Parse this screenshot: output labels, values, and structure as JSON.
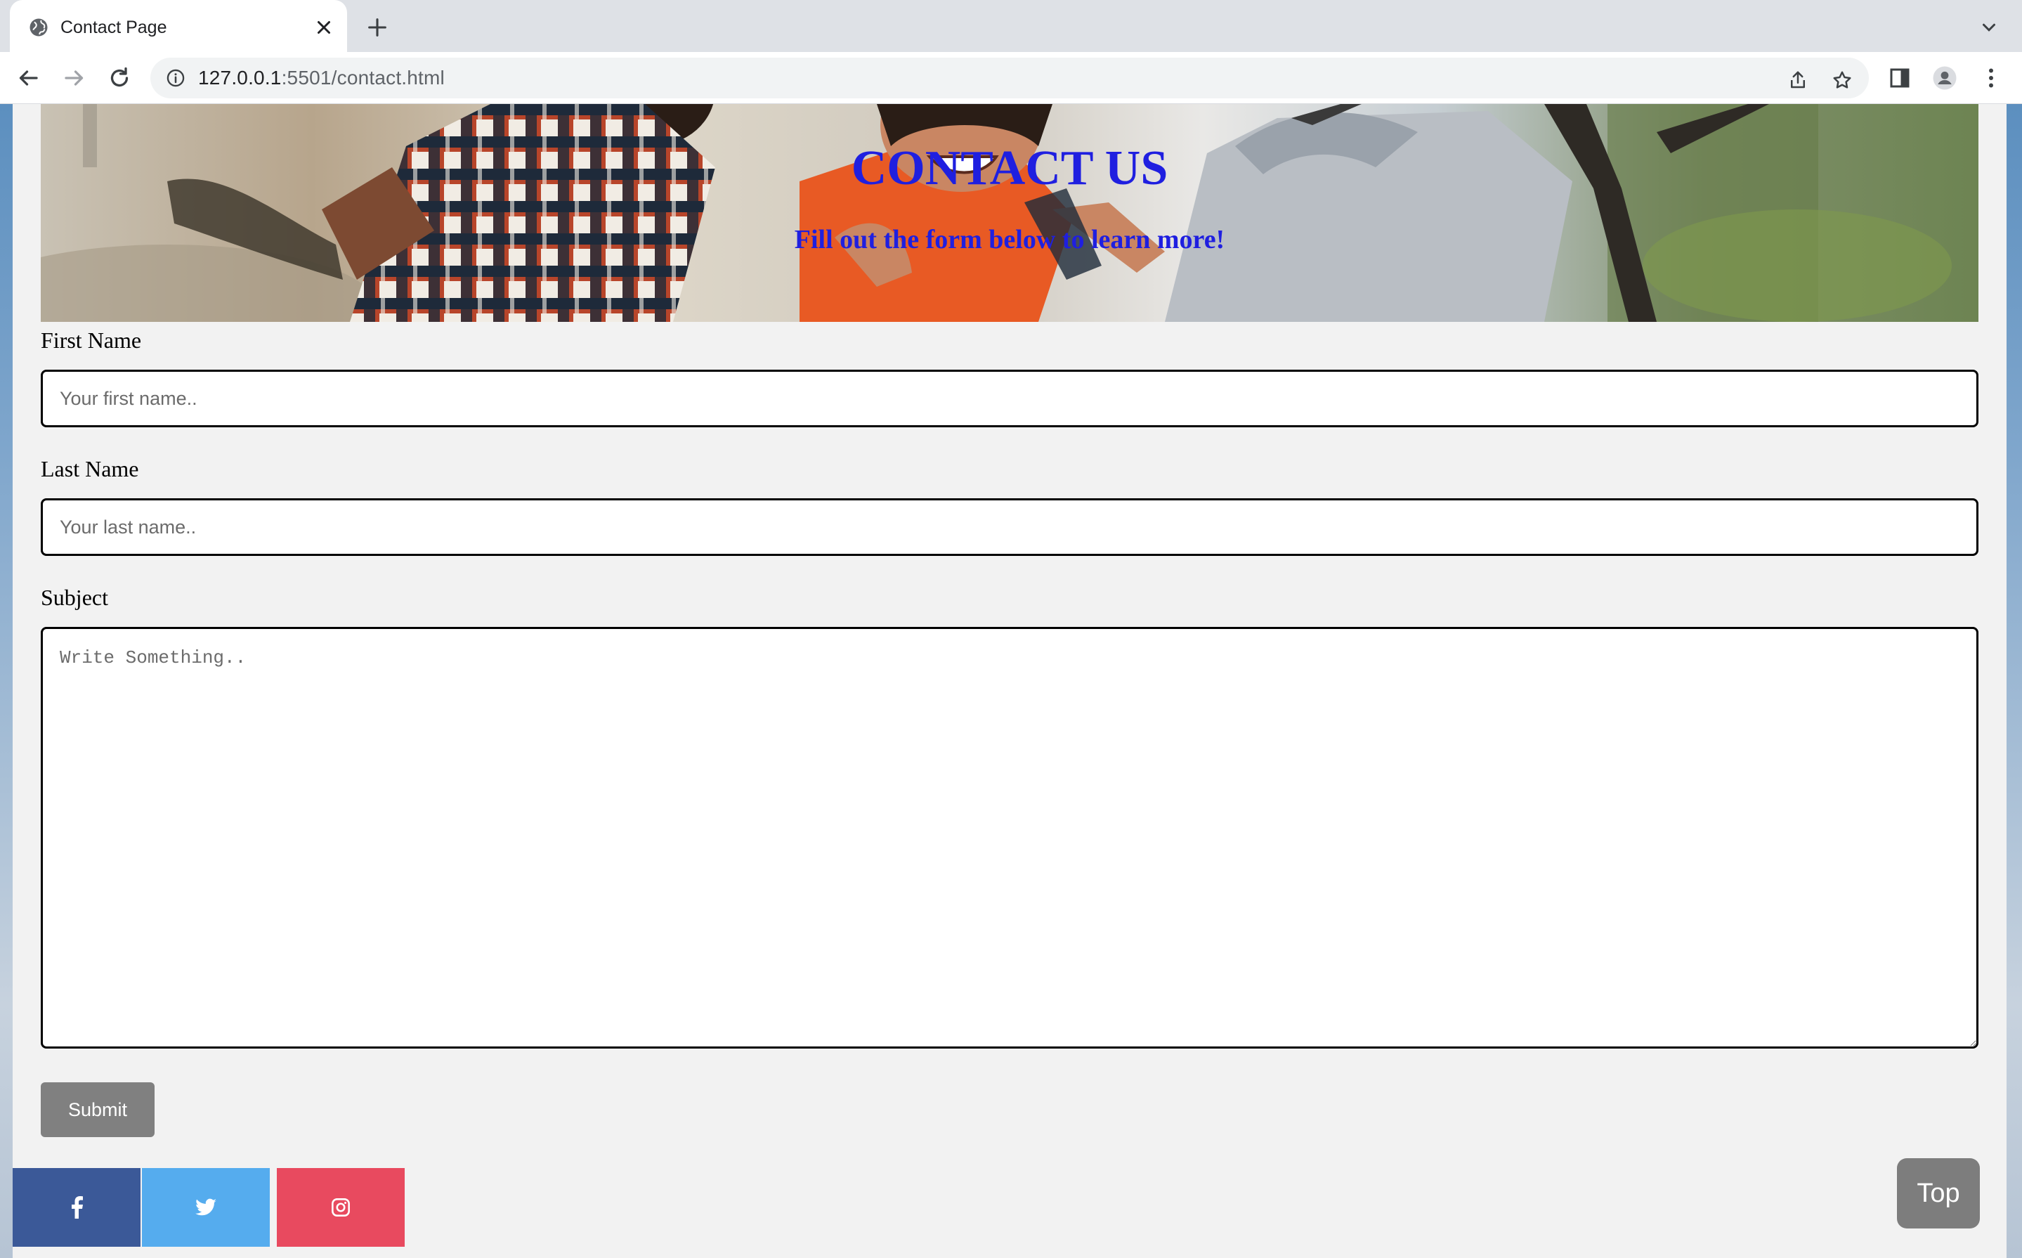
{
  "browser": {
    "tab_title": "Contact Page",
    "url_host": "127.0.0.1",
    "url_rest": ":5501/contact.html"
  },
  "hero": {
    "title": "CONTACT US",
    "subtitle": "Fill out the form below to learn more!"
  },
  "form": {
    "first_name_label": "First Name",
    "first_name_placeholder": "Your first name..",
    "last_name_label": "Last Name",
    "last_name_placeholder": "Your last name..",
    "subject_label": "Subject",
    "subject_placeholder": "Write Something..",
    "submit_label": "Submit"
  },
  "social": [
    {
      "name": "facebook",
      "color": "#3b5998"
    },
    {
      "name": "twitter",
      "color": "#55acee"
    },
    {
      "name": "instagram",
      "color": "#e84a5f"
    }
  ],
  "top_button_label": "Top",
  "colors": {
    "heading_blue": "#1f1fe0",
    "button_gray": "#808080"
  }
}
